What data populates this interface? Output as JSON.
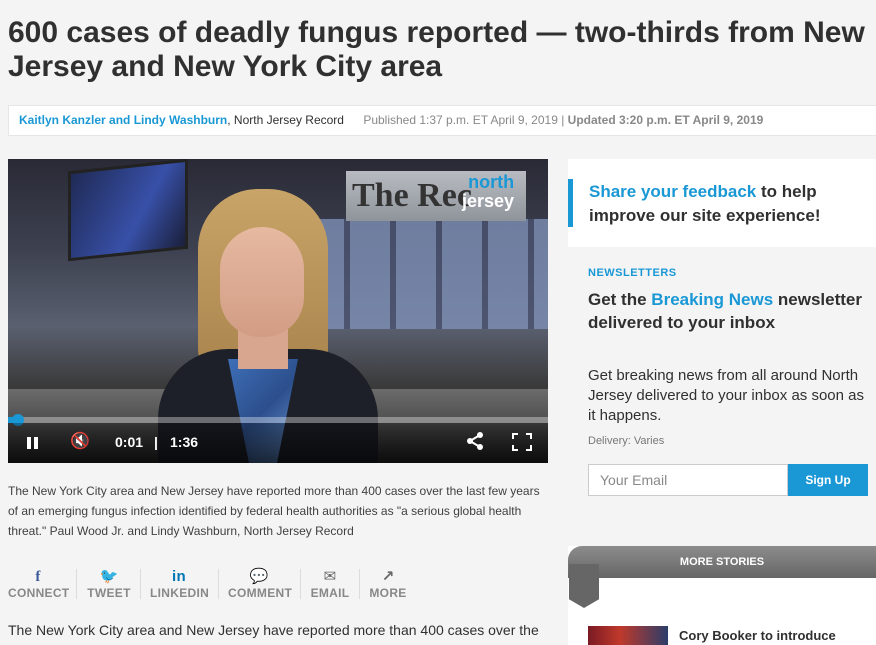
{
  "article": {
    "headline": "600 cases of deadly fungus reported — two-thirds from New Jersey and New York City area",
    "authors": "Kaitlyn Kanzler and Lindy Washburn",
    "org": ", North Jersey Record",
    "published": "Published 1:37 p.m. ET April 9, 2019 | ",
    "updated": "Updated 3:20 p.m. ET April 9, 2019",
    "caption": "The New York City area and New Jersey have reported more than 400 cases over the last few years of an emerging fungus infection identified by federal health authorities as \"a serious global health threat.\" Paul Wood Jr. and Lindy Washburn, North Jersey Record",
    "body_first_line": "The New York City area and New Jersey have reported more than 400 cases over the"
  },
  "video": {
    "logo_line1": "north",
    "logo_line2": "jersey",
    "sign_text": "The Rec",
    "current_time": "0:01",
    "separator": "|",
    "duration": "1:36",
    "progress_fraction": 0.0104
  },
  "social": [
    {
      "icon": "f",
      "label": "CONNECT"
    },
    {
      "icon": "🐦",
      "label": "TWEET"
    },
    {
      "icon": "in",
      "label": "LINKEDIN"
    },
    {
      "icon": "💬",
      "label": "COMMENT"
    },
    {
      "icon": "✉",
      "label": "EMAIL"
    },
    {
      "icon": "↗",
      "label": "MORE"
    }
  ],
  "feedback": {
    "link": "Share your feedback",
    "rest": " to help improve our site experience!"
  },
  "newsletter": {
    "label": "NEWSLETTERS",
    "title_pre": "Get the ",
    "title_link": "Breaking News",
    "title_post": " newsletter delivered to your inbox",
    "description": "Get breaking news from all around North Jersey delivered to your inbox as soon as it happens.",
    "delivery": "Delivery: Varies",
    "email_placeholder": "Your Email",
    "signup_label": "Sign Up"
  },
  "more_stories": {
    "header": "MORE STORIES",
    "first_title": "Cory Booker to introduce"
  },
  "colors": {
    "accent": "#1a98d5",
    "text": "#303030",
    "muted": "#888888"
  }
}
